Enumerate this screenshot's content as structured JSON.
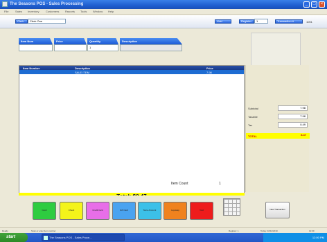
{
  "window": {
    "title": "The Seasons POS - Sales Processing",
    "minimize": "_",
    "maximize": "□",
    "close": "×"
  },
  "menu": [
    "File",
    "Sales",
    "Inventory",
    "Customers",
    "Reports",
    "Tools",
    "Window",
    "Help"
  ],
  "toolbar": {
    "user_label": "Clerk",
    "user_value": "Clerk One",
    "btn_void": "Void",
    "btn_register": "Register",
    "register_value": "1",
    "btn_transaction": "Transaction #",
    "transaction_value": "1001"
  },
  "entry": {
    "item_num_label": "Item Num",
    "price_label": "Price",
    "quantity_label": "Quantity",
    "quantity_value": "1",
    "description_label": "Description"
  },
  "grid": {
    "columns": [
      "Item Number",
      "Description",
      "Price"
    ],
    "rows": [
      {
        "item_number": "",
        "description": "SALE ITEM",
        "price": "7.98"
      }
    ]
  },
  "totals": {
    "subtotal_label": "Subtotal",
    "subtotal_value": "7.98",
    "taxable_label": "Taxable",
    "taxable_value": "7.98",
    "tax_label": "Tax",
    "tax_value": "0.49",
    "total_label": "TOTAL",
    "total_value": "8.47"
  },
  "total_bar": "Total: $8.47",
  "item_count": {
    "label": "Item Count",
    "value": "1"
  },
  "actions": [
    {
      "label": "Cash",
      "color": "#2ecc40"
    },
    {
      "label": "Check",
      "color": "#f4f41a"
    },
    {
      "label": "Credit Card",
      "color": "#e86ee8"
    },
    {
      "label": "Gift Card",
      "color": "#4aa3f0"
    },
    {
      "label": "Store Account",
      "color": "#3cc0e8"
    },
    {
      "label": "Layaway",
      "color": "#f0821e"
    },
    {
      "label": "Void",
      "color": "#ee1c1c"
    }
  ],
  "new_transaction": "New Transaction",
  "status": {
    "left": "Ready",
    "middle": "Scan or enter item number",
    "register": "Register: 1",
    "date": "Today: 02/12/2010",
    "time": "12:00"
  },
  "taskbar": {
    "start": "start",
    "task": "The Seasons POS - Sales Proce...",
    "clock": "12:00 PM"
  }
}
